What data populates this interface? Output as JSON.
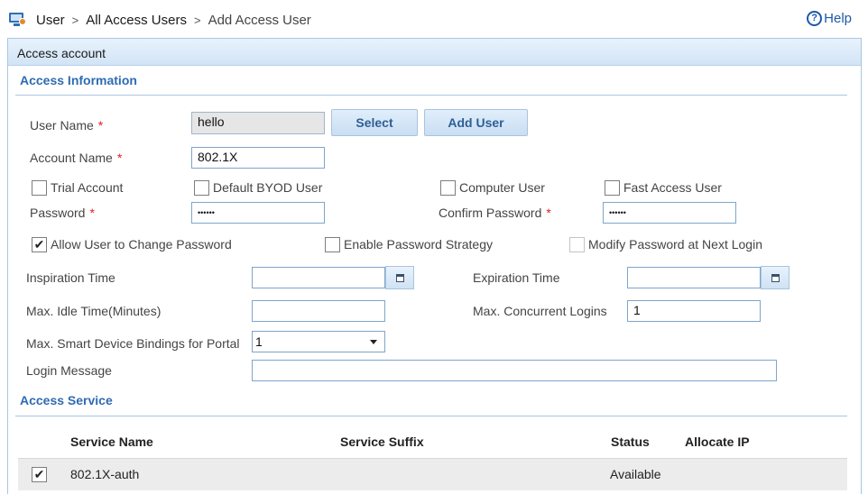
{
  "breadcrumb": {
    "items": [
      "User",
      "All Access Users"
    ],
    "separator": ">",
    "current": "Add Access User",
    "icon": "user-management-icon"
  },
  "help": {
    "label": "Help",
    "icon": "question-circle-icon"
  },
  "panel": {
    "title": "Access account"
  },
  "access_information": {
    "title": "Access Information",
    "user_name": {
      "label": "User Name",
      "required": "*",
      "value": "hello"
    },
    "select_button": "Select",
    "add_user_button": "Add User",
    "account_name": {
      "label": "Account Name",
      "required": "*",
      "value": "802.1X"
    },
    "checkboxes_row1": [
      {
        "label": "Trial Account",
        "checked": false
      },
      {
        "label": "Default BYOD User",
        "checked": false
      },
      {
        "label": "Computer User",
        "checked": false
      },
      {
        "label": "Fast Access User",
        "checked": false
      }
    ],
    "password": {
      "label": "Password",
      "required": "*",
      "value": "••••••"
    },
    "confirm_password": {
      "label": "Confirm Password",
      "required": "*",
      "value": "••••••"
    },
    "checkboxes_row2": [
      {
        "label": "Allow User to Change Password",
        "checked": true
      },
      {
        "label": "Enable Password Strategy",
        "checked": false
      },
      {
        "label": "Modify Password at Next Login",
        "checked": false,
        "disabled": true
      }
    ],
    "inspiration_time": {
      "label": "Inspiration Time",
      "value": ""
    },
    "expiration_time": {
      "label": "Expiration Time",
      "value": ""
    },
    "max_idle_time": {
      "label": "Max. Idle Time(Minutes)",
      "value": ""
    },
    "max_concurrent_logins": {
      "label": "Max. Concurrent Logins",
      "value": "1"
    },
    "max_smart_device_bindings": {
      "label": "Max. Smart Device Bindings for Portal",
      "value": "1"
    },
    "login_message": {
      "label": "Login Message",
      "value": ""
    }
  },
  "access_service": {
    "title": "Access Service",
    "columns": [
      "Service Name",
      "Service Suffix",
      "Status",
      "Allocate IP"
    ],
    "rows": [
      {
        "checked": true,
        "service_name": "802.1X-auth",
        "service_suffix": "",
        "status": "Available",
        "allocate_ip": ""
      }
    ]
  },
  "colors": {
    "accent": "#2e6bb1",
    "required": "#e02020",
    "border": "#a9c6e3"
  }
}
